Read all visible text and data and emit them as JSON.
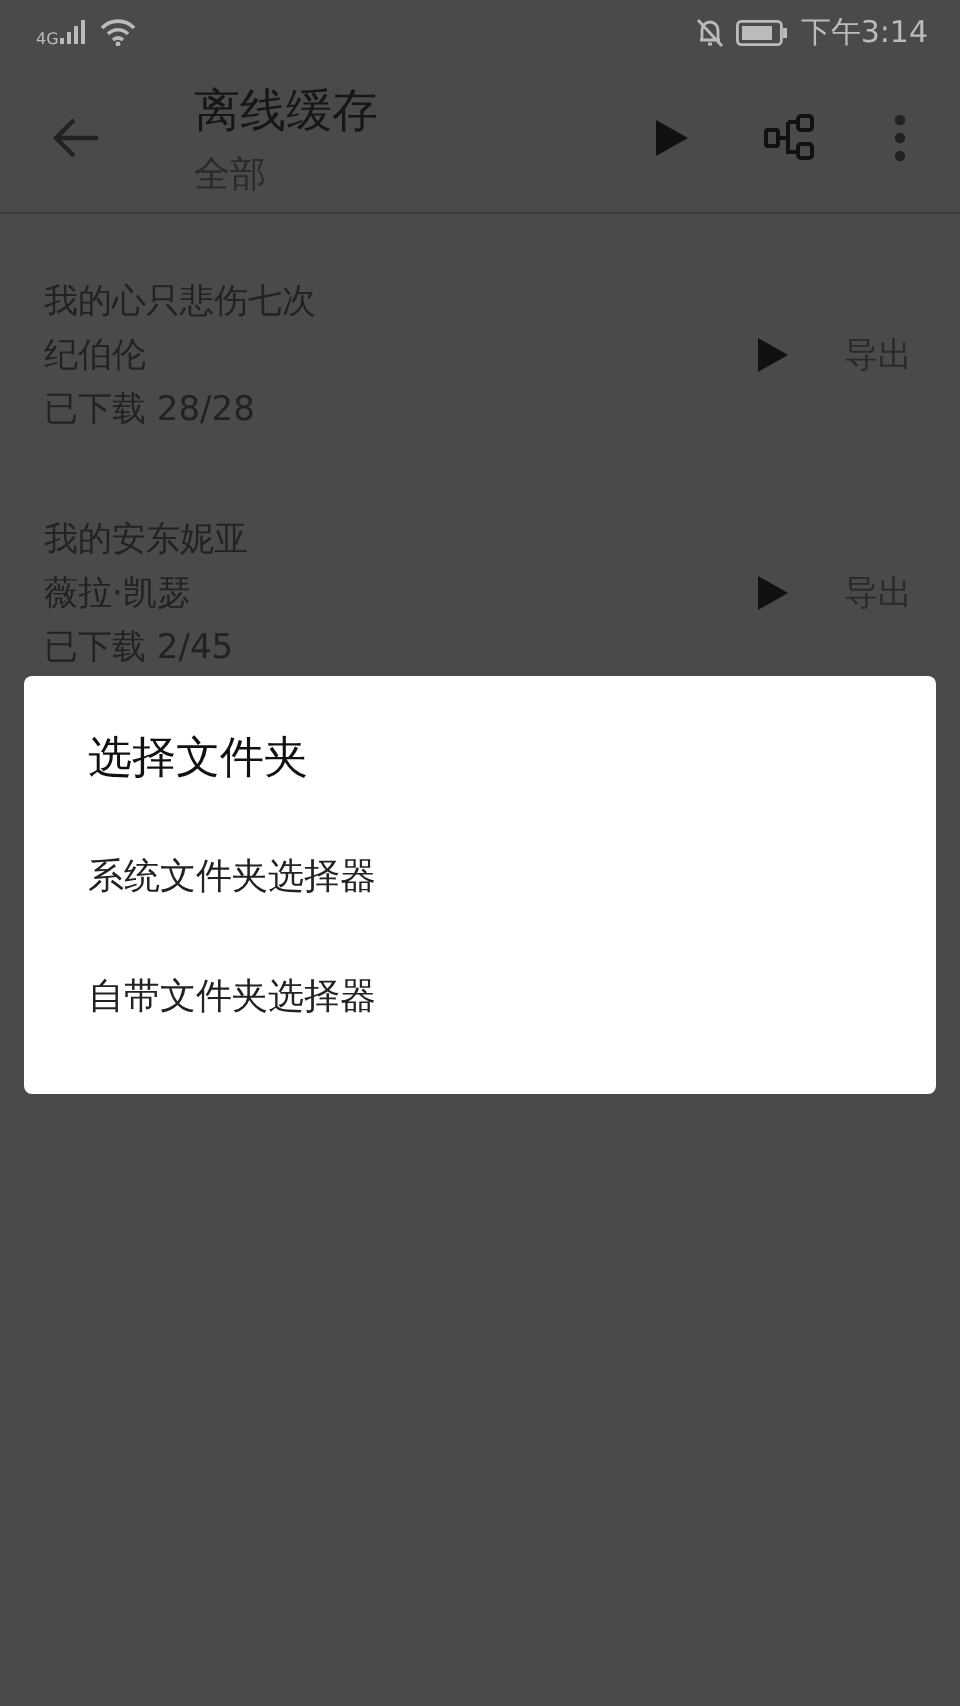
{
  "status_bar": {
    "network": "4G",
    "time": "下午3:14"
  },
  "toolbar": {
    "title": "离线缓存",
    "subtitle": "全部"
  },
  "downloads": [
    {
      "title": "我的心只悲伤七次",
      "artist": "纪伯伦",
      "progress": "已下载 28/28",
      "action": "导出"
    },
    {
      "title": "我的安东妮亚",
      "artist": "薇拉·凯瑟",
      "progress": "已下载 2/45",
      "action": "导出"
    }
  ],
  "dialog": {
    "title": "选择文件夹",
    "options": [
      "系统文件夹选择器",
      "自带文件夹选择器"
    ]
  }
}
